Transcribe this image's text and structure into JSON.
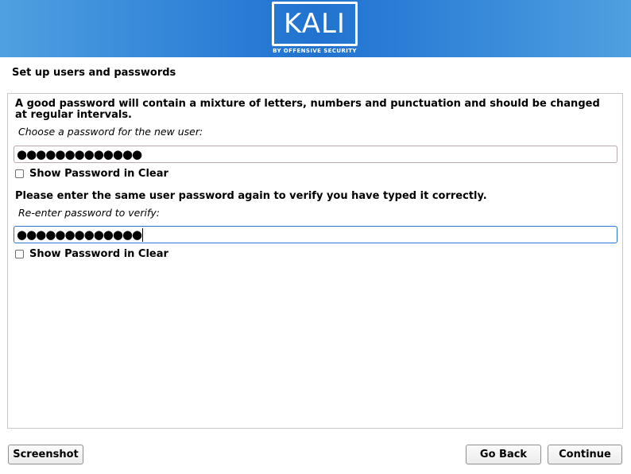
{
  "banner": {
    "logo_text": "KALI",
    "logo_subtitle": "BY OFFENSIVE SECURITY"
  },
  "page_title": "Set up users and passwords",
  "password_section": {
    "description": "A good password will contain a mixture of letters, numbers and punctuation and should be changed at regular intervals.",
    "field_label": "Choose a password for the new user:",
    "masked_value": "●●●●●●●●●●●●●",
    "show_clear_label": "Show Password in Clear",
    "show_clear_checked": false
  },
  "verify_section": {
    "description": "Please enter the same user password again to verify you have typed it correctly.",
    "field_label": "Re-enter password to verify:",
    "masked_value": "●●●●●●●●●●●●●",
    "show_clear_label": "Show Password in Clear",
    "show_clear_checked": false
  },
  "buttons": {
    "screenshot": "Screenshot",
    "go_back": "Go Back",
    "continue": "Continue"
  },
  "colors": {
    "banner_blue": "#2173cf",
    "focus_border": "#2c73d2"
  }
}
